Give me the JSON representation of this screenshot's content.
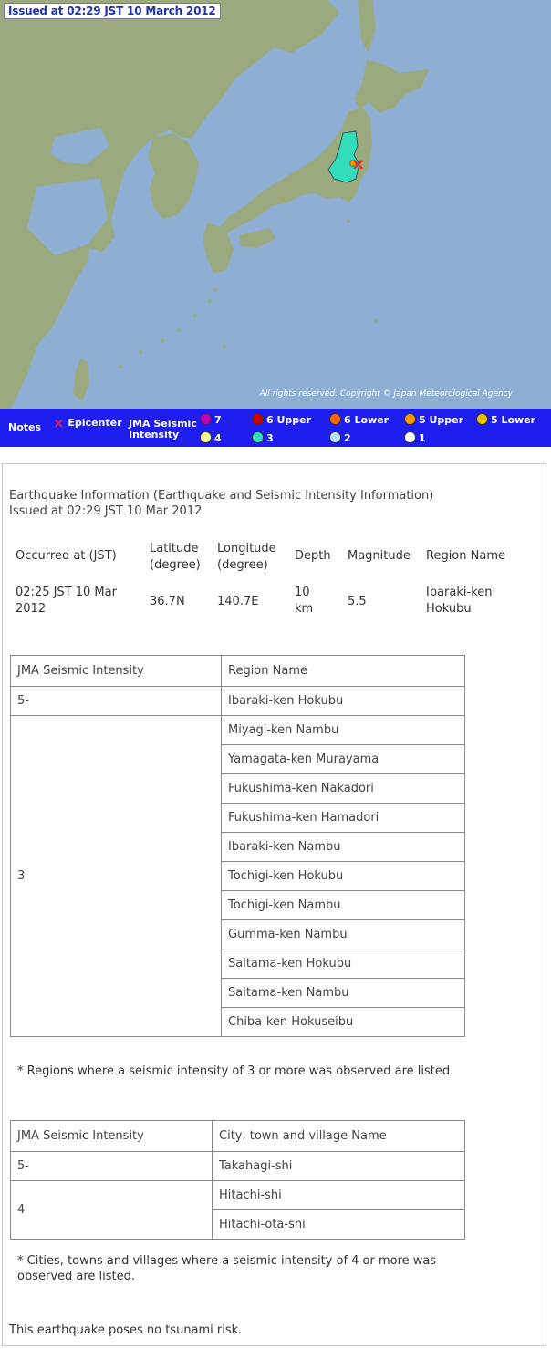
{
  "map": {
    "issued": "Issued at 02:29 JST  10 March 2012",
    "copyright": "All rights reserved. Copyright © Japan Meteorological Agency"
  },
  "legend": {
    "notes": "Notes",
    "epicenter": "Epicenter",
    "intensity_title_line1": "JMA Seismic",
    "intensity_title_line2": "Intensity",
    "items": [
      {
        "label": "7",
        "color": "#c000c0"
      },
      {
        "label": "6 Upper",
        "color": "#cc0000"
      },
      {
        "label": "6 Lower",
        "color": "#ff6600"
      },
      {
        "label": "5 Upper",
        "color": "#ff9900"
      },
      {
        "label": "5 Lower",
        "color": "#e8c000"
      },
      {
        "label": "4",
        "color": "#ffff99"
      },
      {
        "label": "3",
        "color": "#33ddbb"
      },
      {
        "label": "2",
        "color": "#bbddff"
      },
      {
        "label": "1",
        "color": "#ffffff"
      }
    ]
  },
  "info": {
    "heading1": "Earthquake Information (Earthquake and Seismic Intensity Information)",
    "heading2": "Issued at 02:29 JST 10 Mar 2012",
    "headers": {
      "occurred": "Occurred at (JST)",
      "lat1": "Latitude",
      "lat2": "(degree)",
      "lon1": "Longitude",
      "lon2": "(degree)",
      "depth": "Depth",
      "magnitude": "Magnitude",
      "region": "Region Name"
    },
    "values": {
      "occurred1": "02:25 JST 10 Mar",
      "occurred2": "2012",
      "lat": "36.7N",
      "lon": "140.7E",
      "depth1": "10",
      "depth2": "km",
      "magnitude": "5.5",
      "region1": "Ibaraki-ken",
      "region2": "Hokubu"
    }
  },
  "region_table": {
    "col1": "JMA Seismic Intensity",
    "col2": "Region Name",
    "g1_intensity": "5-",
    "g1_regions": [
      "Ibaraki-ken Hokubu"
    ],
    "g2_intensity": "3",
    "g2_regions": [
      "Miyagi-ken Nambu",
      "Yamagata-ken Murayama",
      "Fukushima-ken Nakadori",
      "Fukushima-ken Hamadori",
      "Ibaraki-ken Nambu",
      "Tochigi-ken Hokubu",
      "Tochigi-ken Nambu",
      "Gumma-ken Nambu",
      "Saitama-ken Hokubu",
      "Saitama-ken Nambu",
      "Chiba-ken Hokuseibu"
    ],
    "note": "* Regions where a seismic intensity of 3 or more was observed are listed."
  },
  "city_table": {
    "col1": "JMA Seismic Intensity",
    "col2": "City, town and village Name",
    "g1_intensity": "5-",
    "g1_cities": [
      "Takahagi-shi"
    ],
    "g2_intensity": "4",
    "g2_cities": [
      "Hitachi-shi",
      "Hitachi-ota-shi"
    ],
    "note1": "* Cities, towns and villages where a seismic intensity of 4 or more was",
    "note2": "observed are listed."
  },
  "tsunami": "This earthquake poses no tsunami risk."
}
